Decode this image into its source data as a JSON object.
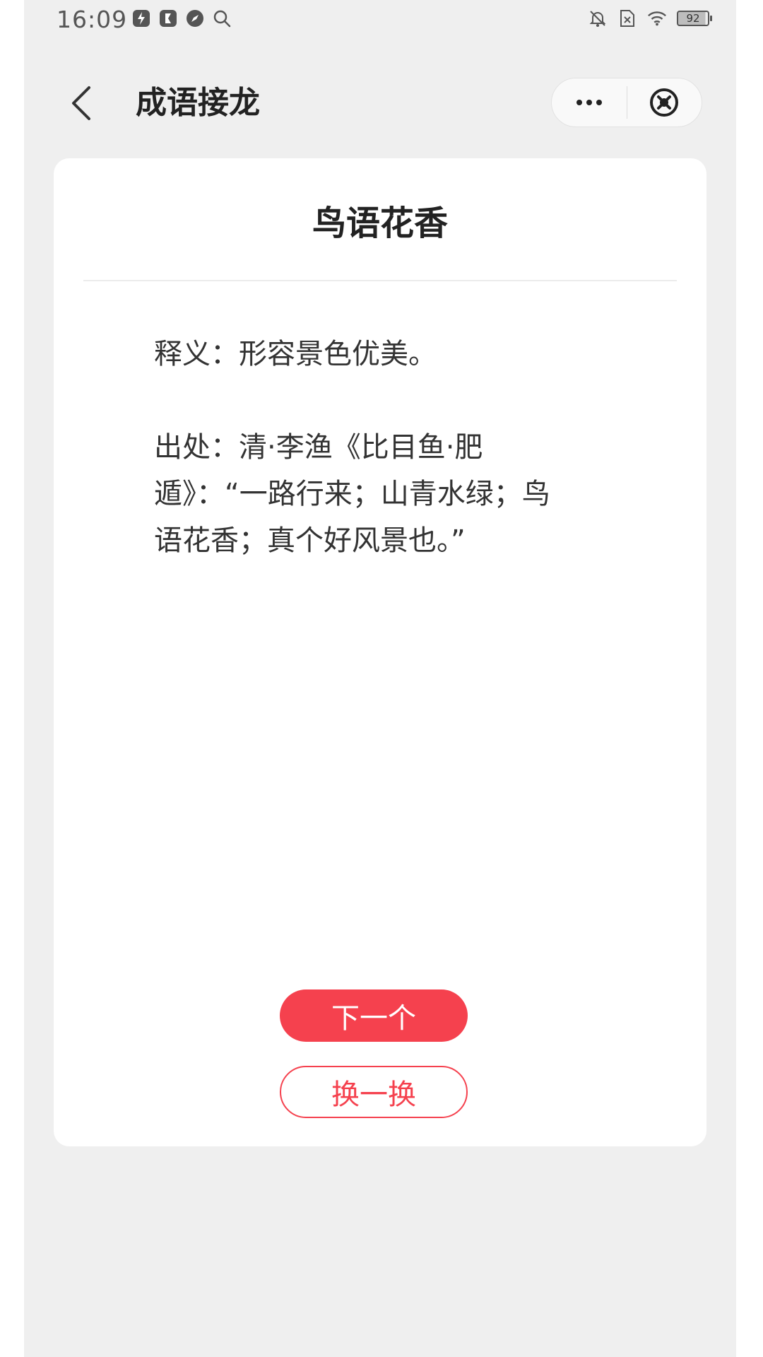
{
  "status_bar": {
    "time": "16:09",
    "battery": "92",
    "icons_left": [
      "flash-app-icon",
      "bookmark-app-icon",
      "compass-app-icon",
      "search-icon"
    ],
    "icons_right": [
      "bell-off-icon",
      "sim-none-icon",
      "wifi-icon",
      "battery-icon"
    ]
  },
  "nav": {
    "title": "成语接龙",
    "more_icon": "more-dots-icon",
    "close_icon": "close-circle-icon"
  },
  "card": {
    "idiom": "鸟语花香",
    "meaning": "释义：形容景色优美。",
    "source": "出处：清·李渔《比目鱼·肥遁》：“一路行来；山青水绿；鸟语花香；真个好风景也。”"
  },
  "buttons": {
    "next_label": "下一个",
    "change_label": "换一换"
  },
  "colors": {
    "accent": "#f5414e",
    "background": "#efefef",
    "card": "#ffffff"
  }
}
